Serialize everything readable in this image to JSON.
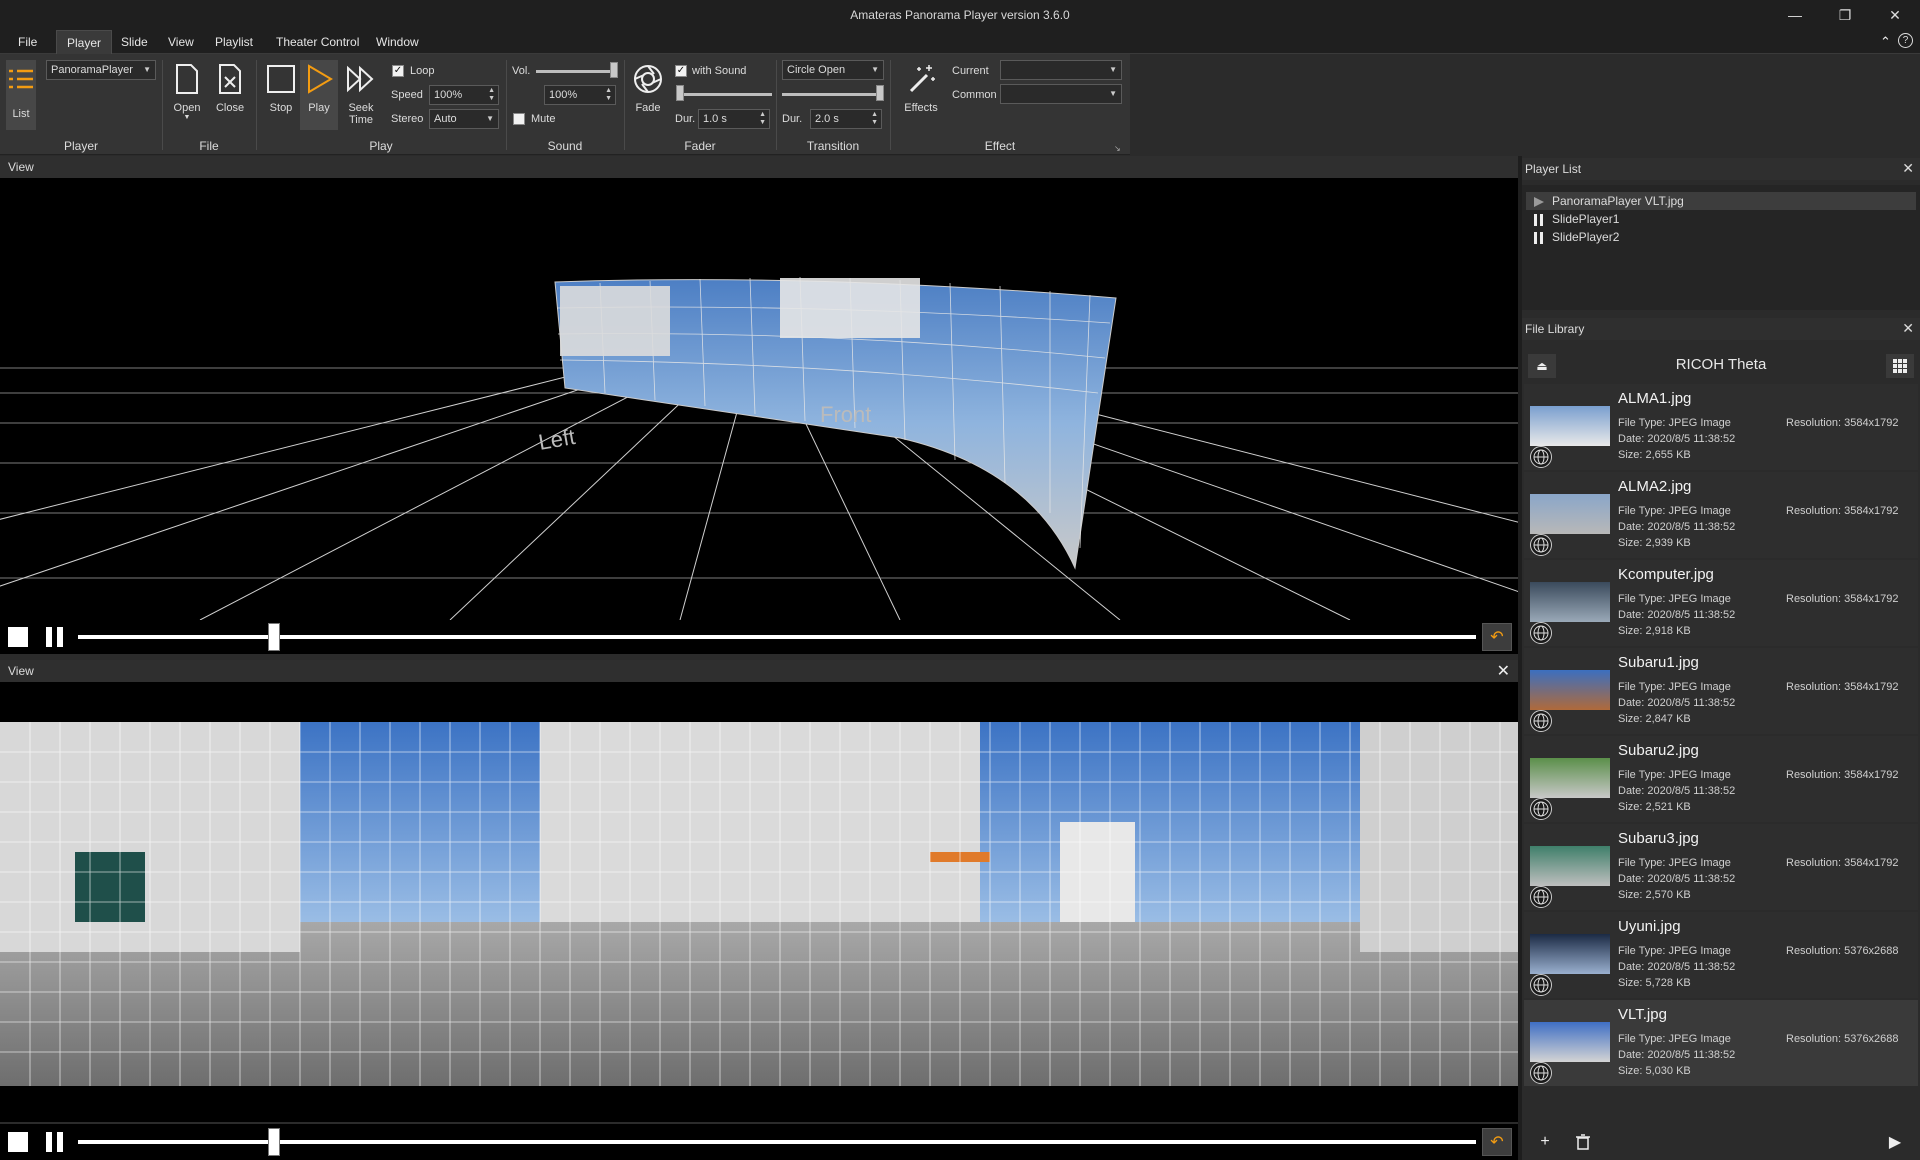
{
  "window": {
    "title": "Amateras Panorama Player version 3.6.0"
  },
  "menu": [
    "File",
    "Player",
    "Slide",
    "View",
    "Playlist",
    "Theater Control",
    "Window"
  ],
  "ribbon": {
    "player": {
      "list_label": "List",
      "player_combo": "PanoramaPlayer",
      "group": "Player"
    },
    "file": {
      "open_label": "Open",
      "close_label": "Close",
      "group": "File"
    },
    "play": {
      "stop_label": "Stop",
      "play_label": "Play",
      "seek_label_1": "Seek",
      "seek_label_2": "Time",
      "loop_label": "Loop",
      "loop_checked": true,
      "speed_label": "Speed",
      "speed_value": "100%",
      "stereo_label": "Stereo",
      "stereo_value": "Auto",
      "group": "Play"
    },
    "sound": {
      "vol_label": "Vol.",
      "vol_value": "100%",
      "mute_label": "Mute",
      "mute_checked": false,
      "group": "Sound",
      "volume_level": 1.0
    },
    "fader": {
      "fade_label": "Fade",
      "with_sound_label": "with Sound",
      "with_sound_checked": true,
      "dur_label": "Dur.",
      "dur_value": "1.0 s",
      "group": "Fader",
      "level": 0.0
    },
    "transition": {
      "combo": "Circle Open",
      "dur_label": "Dur.",
      "dur_value": "2.0 s",
      "group": "Transition",
      "level": 1.0
    },
    "effect": {
      "effects_label": "Effects",
      "current_label": "Current",
      "common_label": "Common",
      "current_value": "",
      "common_value": "",
      "group": "Effect"
    }
  },
  "views": [
    {
      "title": "View",
      "seek_position": 0.14,
      "overlay_left": "Left",
      "overlay_front": "Front"
    },
    {
      "title": "View",
      "seek_position": 0.14
    }
  ],
  "player_list": {
    "title": "Player List",
    "items": [
      {
        "label": "PanoramaPlayer  VLT.jpg",
        "state": "playing"
      },
      {
        "label": "SlidePlayer1",
        "state": "paused"
      },
      {
        "label": "SlidePlayer2",
        "state": "paused"
      }
    ]
  },
  "file_library": {
    "title": "File Library",
    "folder": "RICOH Theta",
    "files": [
      {
        "name": "ALMA1.jpg",
        "type": "File Type: JPEG Image",
        "date": "Date: 2020/8/5 11:38:52",
        "size": "Size: 2,655 KB",
        "resolution": "Resolution: 3584x1792"
      },
      {
        "name": "ALMA2.jpg",
        "type": "File Type: JPEG Image",
        "date": "Date: 2020/8/5 11:38:52",
        "size": "Size: 2,939 KB",
        "resolution": "Resolution: 3584x1792"
      },
      {
        "name": "Kcomputer.jpg",
        "type": "File Type: JPEG Image",
        "date": "Date: 2020/8/5 11:38:52",
        "size": "Size: 2,918 KB",
        "resolution": "Resolution: 3584x1792"
      },
      {
        "name": "Subaru1.jpg",
        "type": "File Type: JPEG Image",
        "date": "Date: 2020/8/5 11:38:52",
        "size": "Size: 2,847 KB",
        "resolution": "Resolution: 3584x1792"
      },
      {
        "name": "Subaru2.jpg",
        "type": "File Type: JPEG Image",
        "date": "Date: 2020/8/5 11:38:52",
        "size": "Size: 2,521 KB",
        "resolution": "Resolution: 3584x1792"
      },
      {
        "name": "Subaru3.jpg",
        "type": "File Type: JPEG Image",
        "date": "Date: 2020/8/5 11:38:52",
        "size": "Size: 2,570 KB",
        "resolution": "Resolution: 3584x1792"
      },
      {
        "name": "Uyuni.jpg",
        "type": "File Type: JPEG Image",
        "date": "Date: 2020/8/5 11:38:52",
        "size": "Size: 5,728 KB",
        "resolution": "Resolution: 5376x2688"
      },
      {
        "name": "VLT.jpg",
        "type": "File Type: JPEG Image",
        "date": "Date: 2020/8/5 11:38:52",
        "size": "Size: 5,030 KB",
        "resolution": "Resolution: 5376x2688"
      }
    ]
  },
  "colors": {
    "accent": "#f39c12",
    "background": "#2b2b2b",
    "view_bg": "#000000"
  },
  "icons": [
    "list-icon",
    "open-icon",
    "close-file-icon",
    "stop-icon",
    "play-icon",
    "seek-icon",
    "fade-icon",
    "effects-icon",
    "eject-icon",
    "grid-icon",
    "add-icon",
    "trash-icon",
    "play-arrow-icon",
    "loop-icon",
    "globe-icon"
  ]
}
